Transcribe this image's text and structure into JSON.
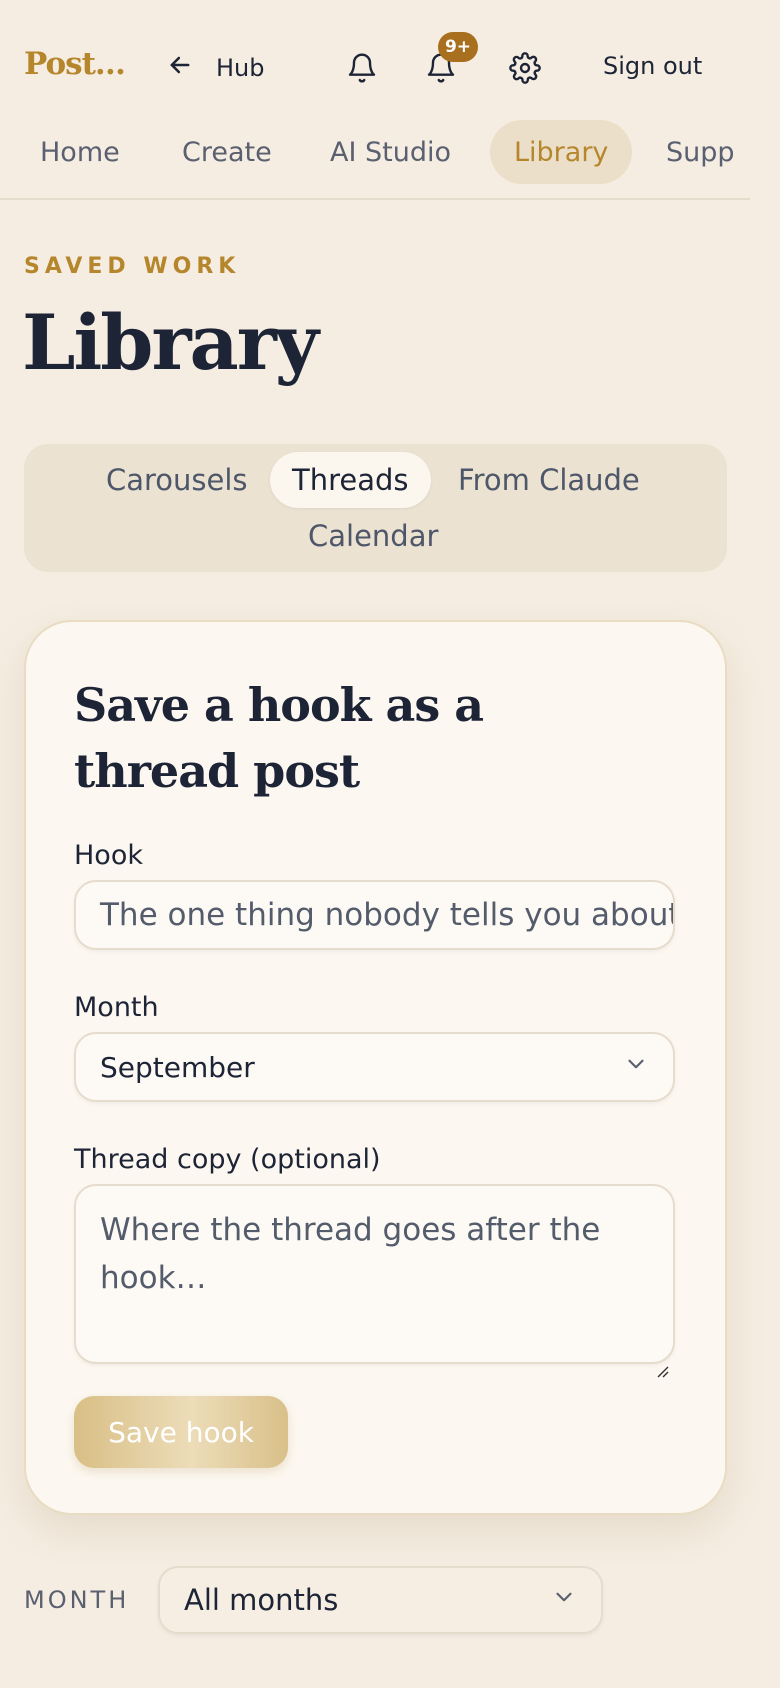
{
  "header": {
    "brand": "Post…",
    "hub_label": "Hub",
    "notifications_badge": "9+",
    "sign_out": "Sign out"
  },
  "nav": {
    "items": [
      {
        "label": "Home",
        "active": false
      },
      {
        "label": "Create",
        "active": false
      },
      {
        "label": "AI Studio",
        "active": false
      },
      {
        "label": "Library",
        "active": true
      },
      {
        "label": "Supp",
        "active": false
      }
    ]
  },
  "page": {
    "eyebrow": "SAVED WORK",
    "title": "Library"
  },
  "segments": {
    "items": [
      {
        "label": "Carousels",
        "active": false
      },
      {
        "label": "Threads",
        "active": true
      },
      {
        "label": "From Claude",
        "active": false
      },
      {
        "label": "Calendar",
        "active": false
      }
    ]
  },
  "form": {
    "title": "Save a hook as a thread post",
    "hook_label": "Hook",
    "hook_placeholder": "The one thing nobody tells you about",
    "month_label": "Month",
    "month_value": "September",
    "thread_label": "Thread copy (optional)",
    "thread_placeholder": "Where the thread goes after the hook…",
    "save_button": "Save hook"
  },
  "filter": {
    "month_label": "MONTH",
    "month_value": "All months"
  },
  "colors": {
    "accent": "#b5862c",
    "background": "#f5ede2",
    "card": "#fcf8f1",
    "badge": "#a86f1e"
  }
}
